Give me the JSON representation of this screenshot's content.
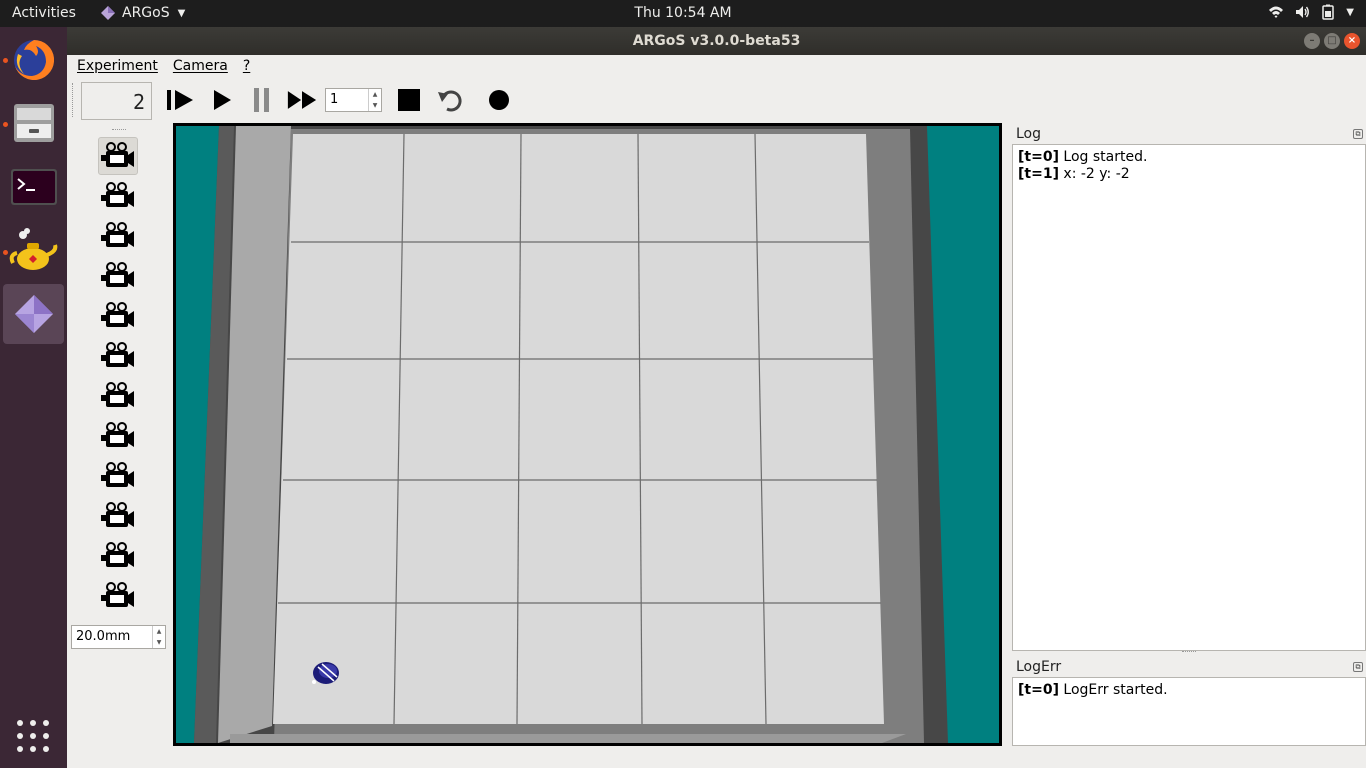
{
  "topbar": {
    "activities": "Activities",
    "app_name": "ARGoS",
    "clock": "Thu 10:54 AM",
    "tray_icons": [
      "wifi-icon",
      "volume-icon",
      "battery-icon",
      "chevron-down-icon"
    ]
  },
  "dock": {
    "items": [
      {
        "name": "firefox",
        "running": true
      },
      {
        "name": "files",
        "running": true
      },
      {
        "name": "terminal",
        "running": false
      },
      {
        "name": "teapot-app",
        "running": true
      },
      {
        "name": "argos",
        "running": true,
        "active": true
      }
    ]
  },
  "window": {
    "title": "ARGoS v3.0.0-beta53"
  },
  "menubar": {
    "experiment": "Experiment",
    "camera": "Camera",
    "help": "?"
  },
  "toolbar": {
    "step_counter": "2",
    "speed_value": "1"
  },
  "camera_sidebar": {
    "camera_count": 12,
    "active_camera": 0,
    "focal_length": "20.0mm"
  },
  "log": {
    "title": "Log",
    "lines": [
      {
        "tag": "[t=0]",
        "text": "Log started."
      },
      {
        "tag": "[t=1]",
        "text": "x: -2 y: -2"
      }
    ]
  },
  "logerr": {
    "title": "LogErr",
    "lines": [
      {
        "tag": "[t=0]",
        "text": "LogErr started."
      }
    ]
  },
  "colors": {
    "teal": "#008080",
    "floor": "#d9d9d9",
    "wall_light": "#a9a9a9",
    "wall_dark": "#474747",
    "robot": "#1c1c78",
    "accent": "#e95420"
  }
}
